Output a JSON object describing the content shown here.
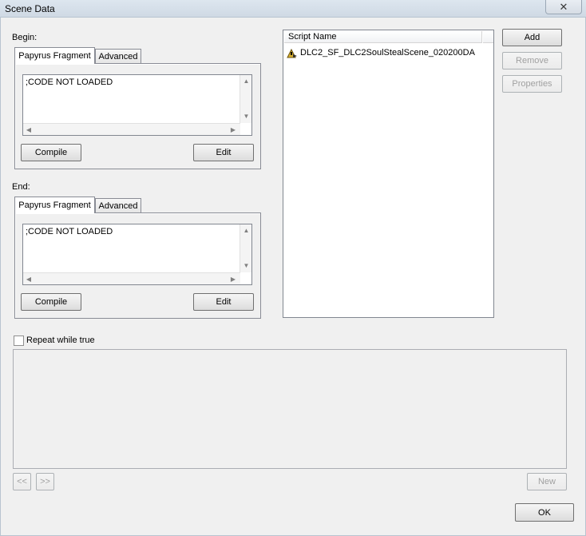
{
  "window": {
    "title": "Scene Data",
    "close_glyph": "✕"
  },
  "begin": {
    "label": "Begin:",
    "tabs": [
      "Papyrus Fragment",
      "Advanced"
    ],
    "code": ";CODE NOT LOADED",
    "compile_label": "Compile",
    "edit_label": "Edit"
  },
  "end": {
    "label": "End:",
    "tabs": [
      "Papyrus Fragment",
      "Advanced"
    ],
    "code": ";CODE NOT LOADED",
    "compile_label": "Compile",
    "edit_label": "Edit"
  },
  "scripts": {
    "column_header": "Script Name",
    "items": [
      {
        "name": "DLC2_SF_DLC2SoulStealScene_020200DA",
        "icon": "script-icon"
      }
    ]
  },
  "side_buttons": {
    "add": "Add",
    "remove": "Remove",
    "properties": "Properties"
  },
  "repeat": {
    "label": "Repeat while true",
    "checked": false
  },
  "nav": {
    "prev": "<<",
    "next": ">>",
    "new": "New"
  },
  "ok_label": "OK"
}
